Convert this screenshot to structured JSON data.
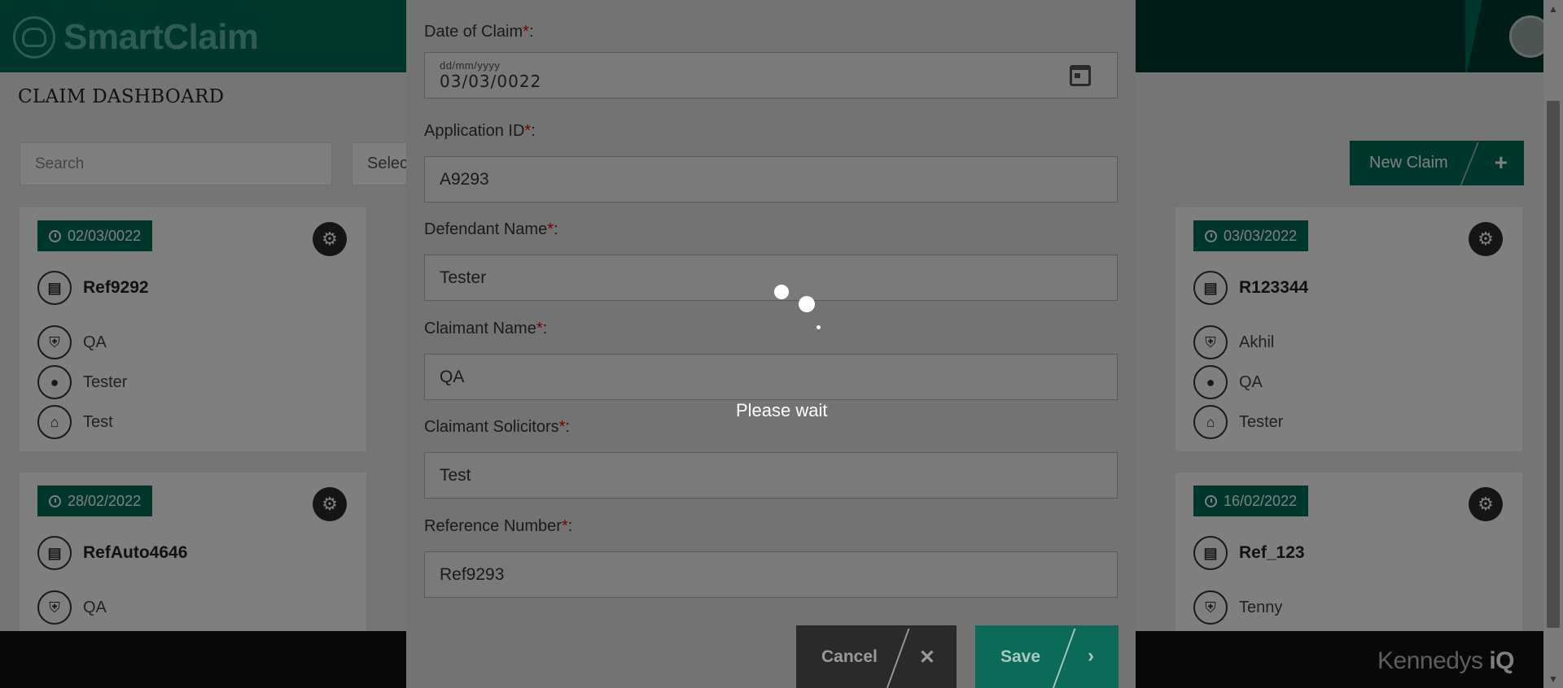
{
  "app": {
    "logo_text": "SmartClaim",
    "page_title": "CLAIM DASHBOARD",
    "footer_brand": "Kennedys",
    "footer_brand_suffix": "iQ"
  },
  "toolbar": {
    "search_placeholder": "Search",
    "select_label": "Selec",
    "new_claim_label": "New Claim",
    "new_claim_icon": "plus-icon"
  },
  "cards": [
    {
      "date": "02/03/0022",
      "reference": "Ref9292",
      "line1": "QA",
      "line2": "Tester",
      "line3": "Test"
    },
    {
      "date": "03/03/2022",
      "reference": "R123344",
      "line1": "Akhil",
      "line2": "QA",
      "line3": "Tester"
    },
    {
      "date": "28/02/2022",
      "reference": "RefAuto4646",
      "line1": "QA"
    },
    {
      "date": "16/02/2022",
      "reference": "Ref_123",
      "line1": "Tenny"
    }
  ],
  "modal": {
    "fields": [
      {
        "label": "Date of Claim",
        "placeholder": "dd/mm/yyyy",
        "value": "03/03/0022"
      },
      {
        "label": "Application ID",
        "value": "A9293"
      },
      {
        "label": "Defendant Name",
        "value": "Tester"
      },
      {
        "label": "Claimant Name",
        "value": "QA"
      },
      {
        "label": "Claimant Solicitors",
        "value": "Test"
      },
      {
        "label": "Reference Number",
        "value": "Ref9293"
      }
    ],
    "required_marker": "*",
    "label_suffix": ":",
    "cancel_label": "Cancel",
    "save_label": "Save"
  },
  "loader": {
    "text": "Please wait"
  },
  "colors": {
    "brand_green": "#006e5a",
    "brand_light": "#5fb8a4",
    "footer_bg": "#111111",
    "required_red": "#b00000"
  }
}
